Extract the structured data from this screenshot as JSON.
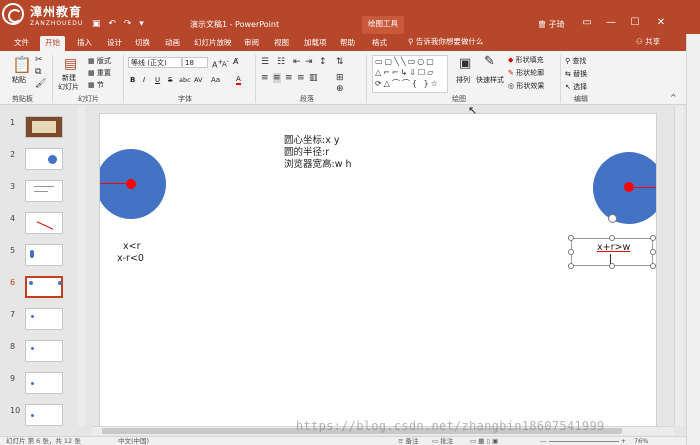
{
  "titlebar": {
    "logo_cn": "漳州教育",
    "logo_en": "ZANZHOUEDU",
    "doc_title": "演示文稿1 - PowerPoint",
    "contextual_tab": "绘图工具",
    "user_name": "曹 子琦",
    "colors": {
      "accent": "#b7472a"
    }
  },
  "tabs": [
    {
      "label": "文件"
    },
    {
      "label": "开始"
    },
    {
      "label": "插入"
    },
    {
      "label": "设计"
    },
    {
      "label": "切换"
    },
    {
      "label": "动画"
    },
    {
      "label": "幻灯片放映"
    },
    {
      "label": "审阅"
    },
    {
      "label": "视图"
    },
    {
      "label": "加载项"
    },
    {
      "label": "帮助"
    },
    {
      "label": "格式"
    }
  ],
  "tell_me": "告诉我你想要做什么",
  "share": "共享",
  "ribbon": {
    "clipboard": {
      "label": "剪贴板",
      "paste": "粘贴"
    },
    "slides": {
      "label": "幻灯片",
      "new_slide": "新建",
      "new_slide2": "幻灯片",
      "layout": "版式",
      "reset": "重置",
      "section": "节"
    },
    "font": {
      "label": "字体",
      "font_name": "等线 (正文)",
      "font_size": "18",
      "bold": "B",
      "italic": "I",
      "underline": "U",
      "strike": "S",
      "shadow": "abc",
      "spacing": "AV",
      "case": "Aa",
      "color": "A"
    },
    "paragraph": {
      "label": "段落"
    },
    "drawing": {
      "label": "绘图",
      "arrange": "排列",
      "quick_styles": "快速样式",
      "fill": "形状填充",
      "outline": "形状轮廓",
      "effects": "形状效果"
    },
    "editing": {
      "label": "编辑",
      "find": "查找",
      "replace": "替换",
      "select": "选择"
    }
  },
  "thumbnails": [
    {
      "num": "1"
    },
    {
      "num": "2"
    },
    {
      "num": "3"
    },
    {
      "num": "4"
    },
    {
      "num": "5"
    },
    {
      "num": "6"
    },
    {
      "num": "7"
    },
    {
      "num": "8"
    },
    {
      "num": "9"
    },
    {
      "num": "10"
    }
  ],
  "slide": {
    "text_block": [
      "圆心坐标:x y",
      "圆的半径:r",
      "浏览器宽高:w h"
    ],
    "left_cond": [
      "x<r",
      "x-r<0"
    ],
    "right_cond": "x+r>w",
    "colors": {
      "circle": "#4472c4",
      "center": "#ff0000"
    }
  },
  "statusbar": {
    "slide_info": "幻灯片 第 6 张，共 12 张",
    "language": "中文(中国)",
    "notes": "备注",
    "comments": "批注",
    "zoom": "76%"
  },
  "watermark": "https://blog.csdn.net/zhangbin18607541999"
}
